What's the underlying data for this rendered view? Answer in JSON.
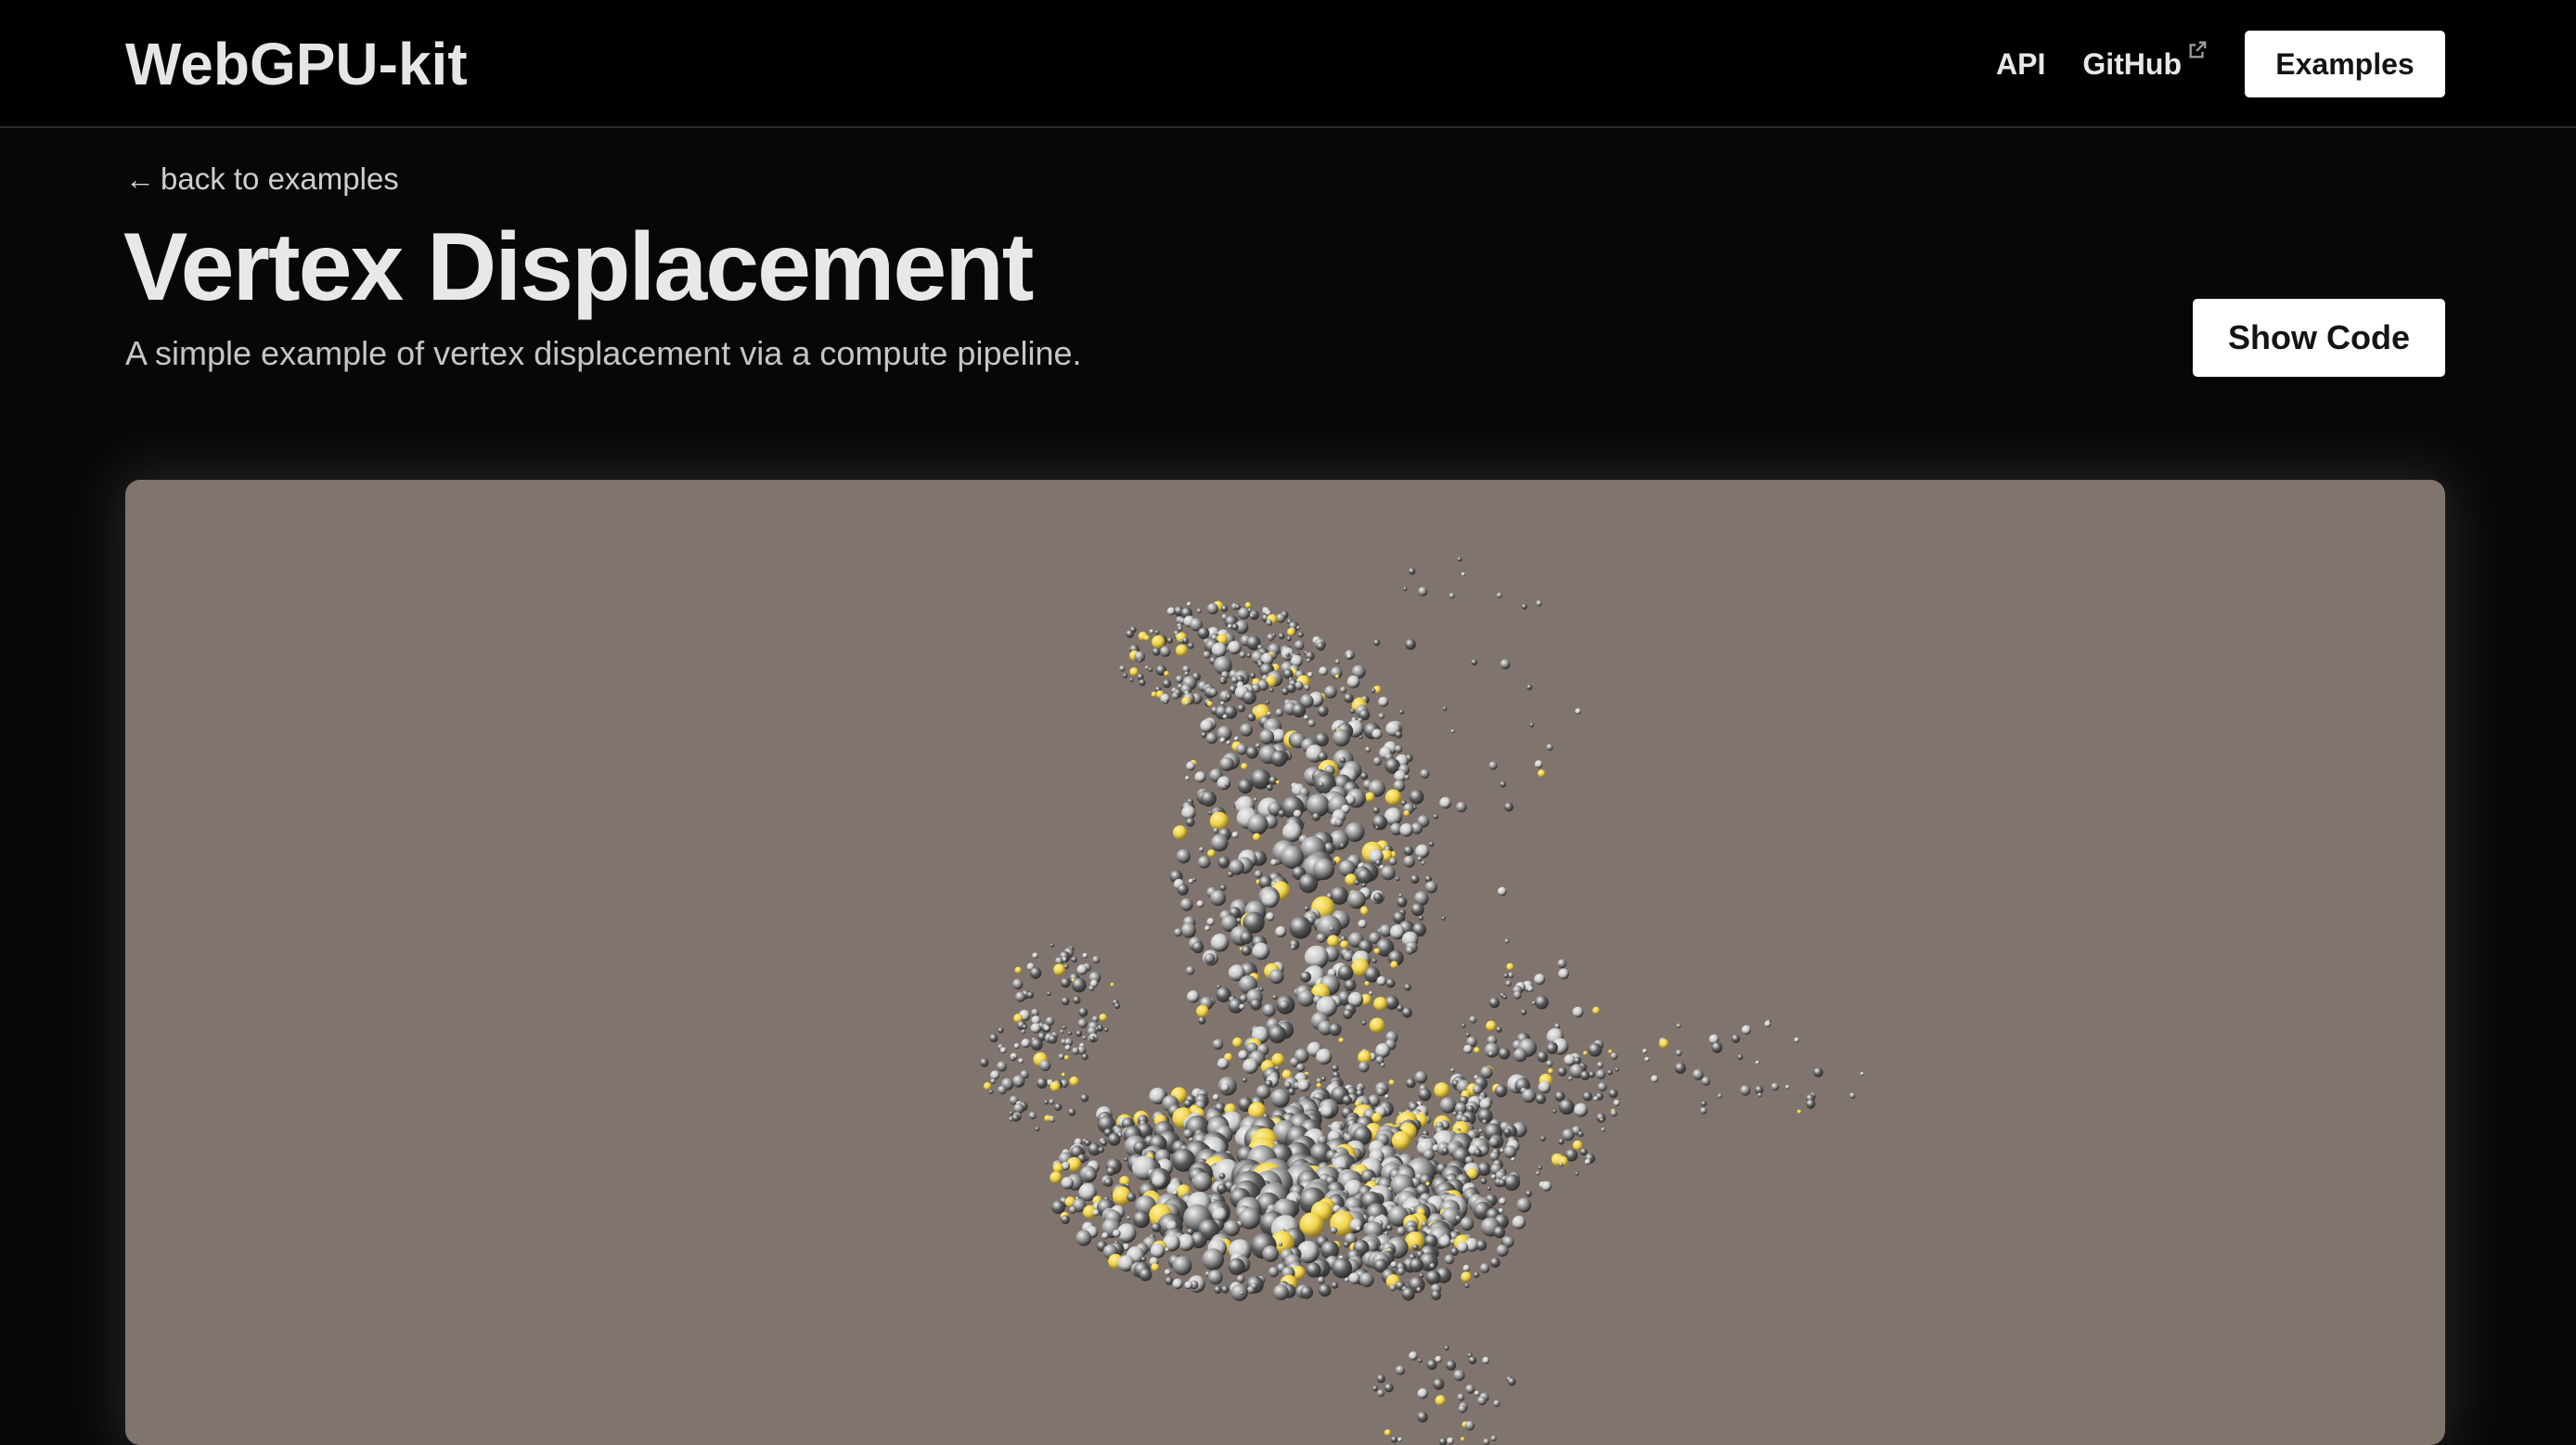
{
  "header": {
    "logo": "WebGPU-kit",
    "nav": {
      "api_label": "API",
      "github_label": "GitHub",
      "external_icon": "external-link-icon",
      "examples_label": "Examples"
    }
  },
  "page": {
    "back_label": "back to examples",
    "back_icon": "arrow-left-icon",
    "title": "Vertex Displacement",
    "subtitle": "A simple example of vertex displacement via a compute pipeline.",
    "show_code_label": "Show Code"
  },
  "canvas": {
    "background": "#80756e",
    "particle_colors": [
      "#5a5a5a",
      "#8c8c8c",
      "#c8c8c8",
      "#f0d24a"
    ]
  }
}
